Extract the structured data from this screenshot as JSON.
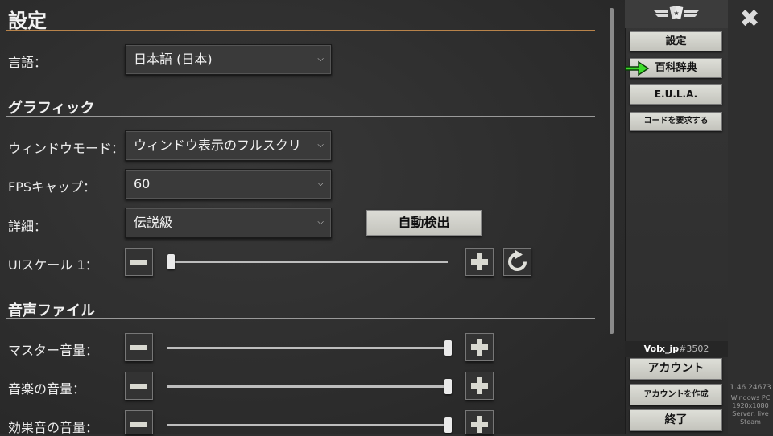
{
  "settings": {
    "title": "設定",
    "language_label": "言語：",
    "language_value": "日本語 (日本)",
    "graphics_header": "グラフィック",
    "window_mode_label": "ウィンドウモード：",
    "window_mode_value": "ウィンドウ表示のフルスクリ",
    "fps_cap_label": "FPSキャップ：",
    "fps_cap_value": "60",
    "detail_label": "詳細：",
    "detail_value": "伝説級",
    "auto_detect_label": "自動検出",
    "ui_scale_label": "UIスケール 1：",
    "ui_scale_level": 0,
    "audio_header": "音声ファイル",
    "master_volume_label": "マスター音量：",
    "master_volume_level": 1.0,
    "music_volume_label": "音楽の音量：",
    "music_volume_level": 1.0,
    "sfx_volume_label": "効果音の音量：",
    "sfx_volume_level": 1.0
  },
  "sidebar": {
    "settings_label": "設定",
    "encyclopedia_label": "百科辞典",
    "eula_label": "E.U.L.A.",
    "request_code_label": "コードを要求する",
    "username": "Volx_jp",
    "user_tag": "#3502",
    "account_label": "アカウント",
    "create_account_label": "アカウントを作成",
    "quit_label": "終了"
  },
  "build_info": {
    "version": "1.46.24673",
    "platform": "Windows PC",
    "resolution": "1920x1080",
    "server": "Server: live",
    "store": "Steam"
  },
  "icons": {
    "close": "close-icon",
    "logo": "card-wings-logo-icon",
    "arrow": "pointer-arrow-icon",
    "reset": "reset-icon"
  },
  "colors": {
    "accent_rule": "#b8834a",
    "arrow_green": "#3ddc2a"
  }
}
